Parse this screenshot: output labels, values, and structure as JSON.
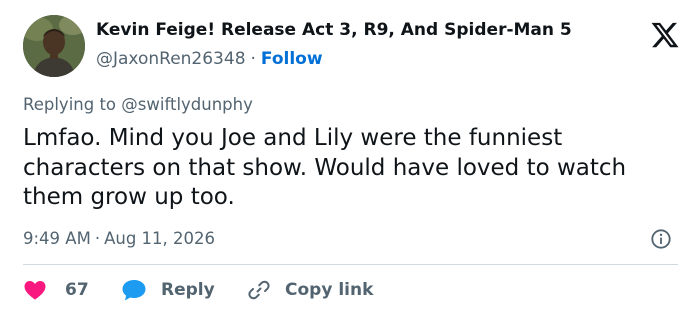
{
  "author": {
    "display_name": "Kevin Feige! Release Act 3, R9, And Spider-Man 5",
    "handle": "@JaxonRen26348",
    "follow_label": "Follow"
  },
  "reply_context": {
    "prefix": "Replying to",
    "mention": "@swiftlydunphy"
  },
  "tweet": {
    "text": "Lmfao. Mind you Joe and Lily were the funniest characters on that show. Would have loved to watch them grow up too.",
    "time": "9:49 AM",
    "date": "Aug 11, 2026"
  },
  "actions": {
    "like_count": "67",
    "reply_label": "Reply",
    "copy_link_label": "Copy link"
  },
  "icons": {
    "platform": "x-logo-icon",
    "info": "info-icon",
    "like": "heart-icon",
    "reply": "speech-bubble-icon",
    "copy_link": "link-icon"
  },
  "colors": {
    "follow": "#006fd6",
    "like": "#f91880",
    "reply": "#1d9bf0",
    "secondary_text": "#536471"
  }
}
